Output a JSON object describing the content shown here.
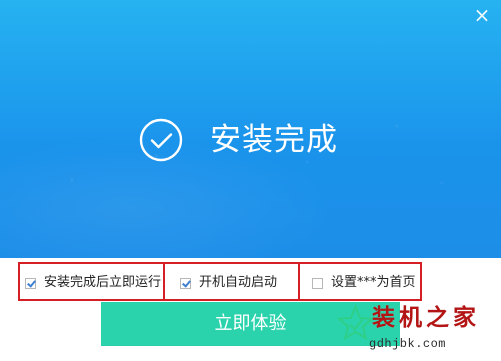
{
  "window": {
    "close_symbol": "×"
  },
  "hero": {
    "status_title": "安装完成",
    "status_icon": "check-circle-icon"
  },
  "options": [
    {
      "label": "安装完成后立即运行",
      "checked": true
    },
    {
      "label": "开机自动启动",
      "checked": true
    },
    {
      "label": "设置***为首页",
      "checked": false
    }
  ],
  "primary_action": {
    "label": "立即体验"
  },
  "watermark": {
    "title": "装机之家",
    "url": "gdhjbk.com"
  },
  "colors": {
    "hero_top": "#26b2f1",
    "hero_bottom": "#1d8ee8",
    "cta": "#2bd3ad",
    "highlight": "#d61f24",
    "watermark_red": "#b31414"
  }
}
